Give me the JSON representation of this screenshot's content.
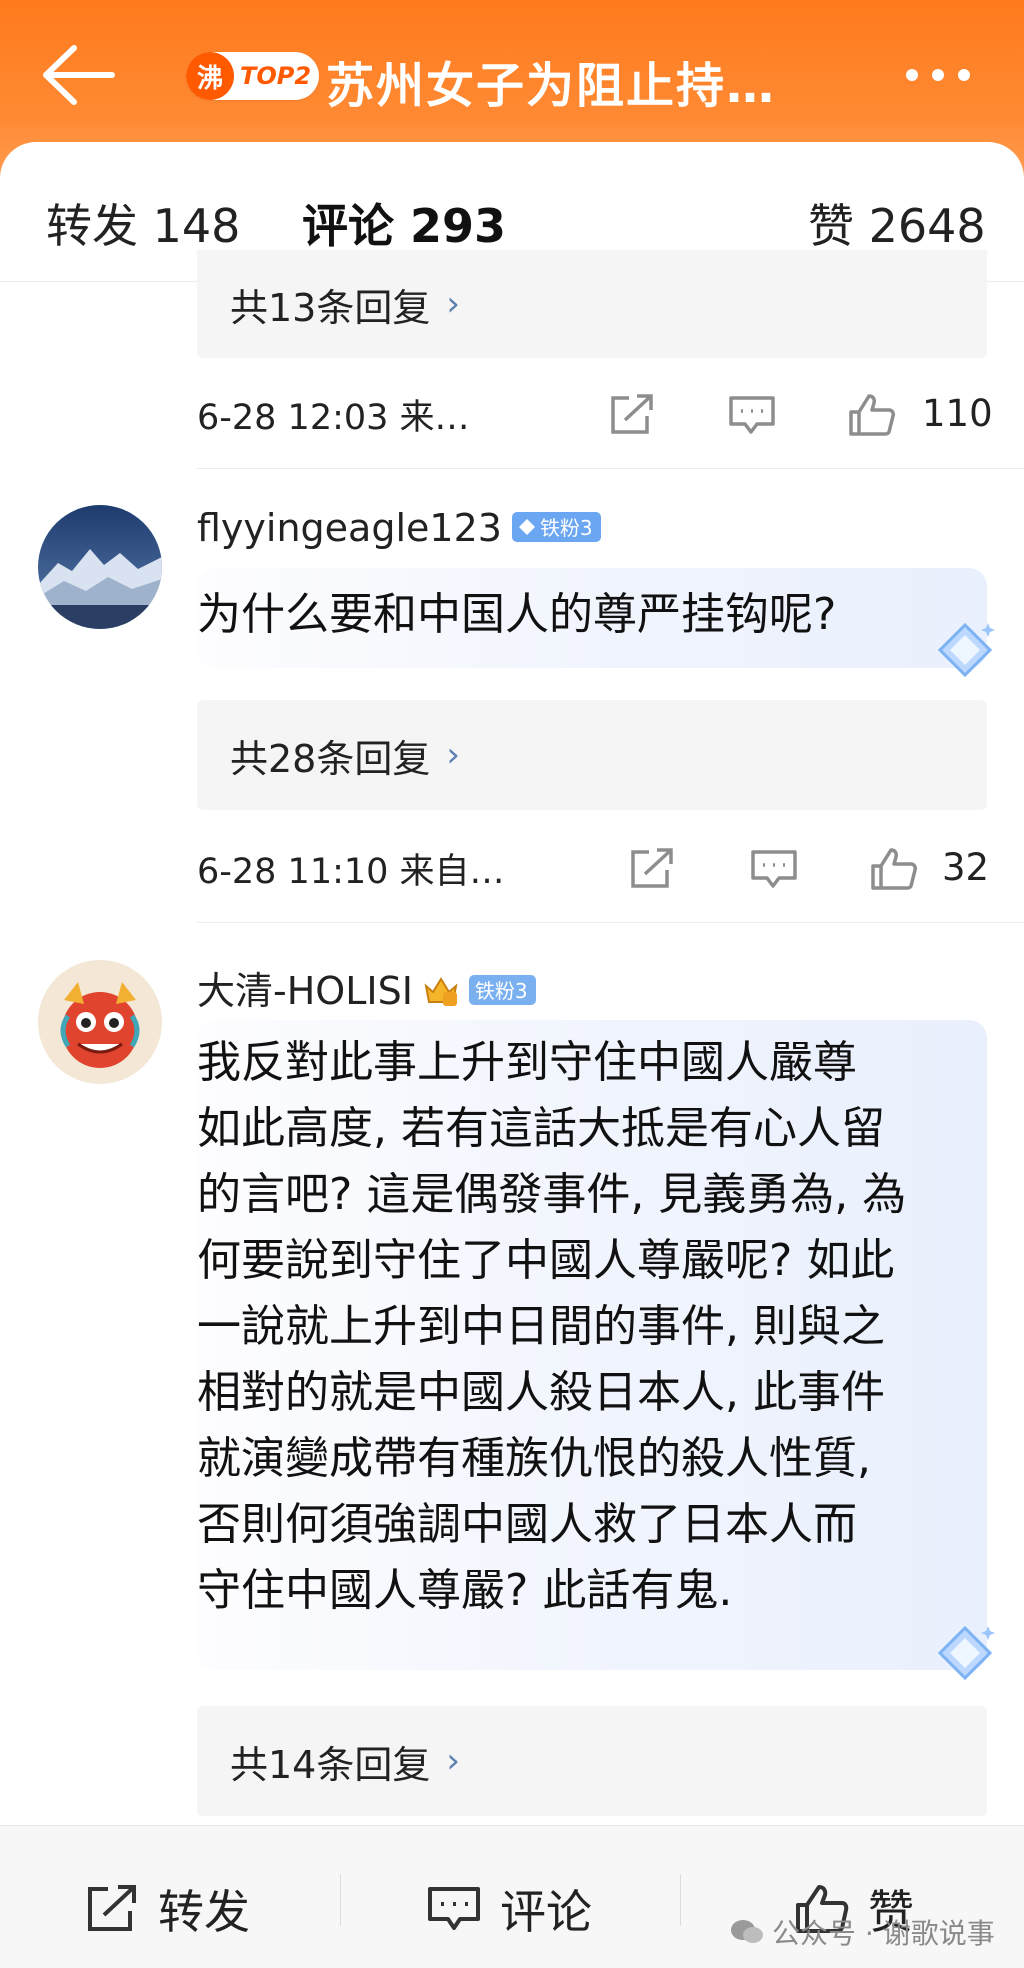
{
  "header": {
    "badge_icon_text": "沸",
    "badge_rank": "TOP2",
    "title": "苏州女子为阻止持…",
    "accent": "#ff7a1c"
  },
  "tabs": [
    {
      "label": "转发 148",
      "active": false
    },
    {
      "label": "评论 293",
      "active": true
    },
    {
      "label": "赞 2648",
      "active": false
    }
  ],
  "comments": [
    {
      "reply_summary": "共13条回复",
      "time": "6-28 12:03  来…",
      "likes": "110"
    },
    {
      "username": "flyyingeagle123",
      "fan_badge": "铁粉3",
      "text": "为什么要和中国人的尊严挂钩呢?",
      "reply_summary": "共28条回复",
      "time": "6-28 11:10  来自…",
      "likes": "32"
    },
    {
      "username": "大清-HOLISI",
      "fan_badge": "铁粉3",
      "text": "我反對此事上升到守住中國人嚴尊\n如此高度, 若有這話大抵是有心人留\n的言吧? 這是偶發事件, 見義勇為, 為\n何要說到守住了中國人尊嚴呢? 如此\n一說就上升到中日間的事件, 則與之\n相對的就是中國人殺日本人, 此事件\n就演變成帶有種族仇恨的殺人性質,\n否則何須強調中國人救了日本人而\n守住中國人尊嚴? 此話有鬼.",
      "reply_summary": "共14条回复"
    }
  ],
  "bottom_bar": {
    "repost_label": "转发",
    "comment_label": "评论",
    "like_label": "赞"
  },
  "watermark": "公众号 · 谢歌说事",
  "icons": [
    "back-arrow-icon",
    "more-icon",
    "repost-icon",
    "comment-icon",
    "like-icon",
    "chevron-right-icon",
    "diamond-icon"
  ]
}
